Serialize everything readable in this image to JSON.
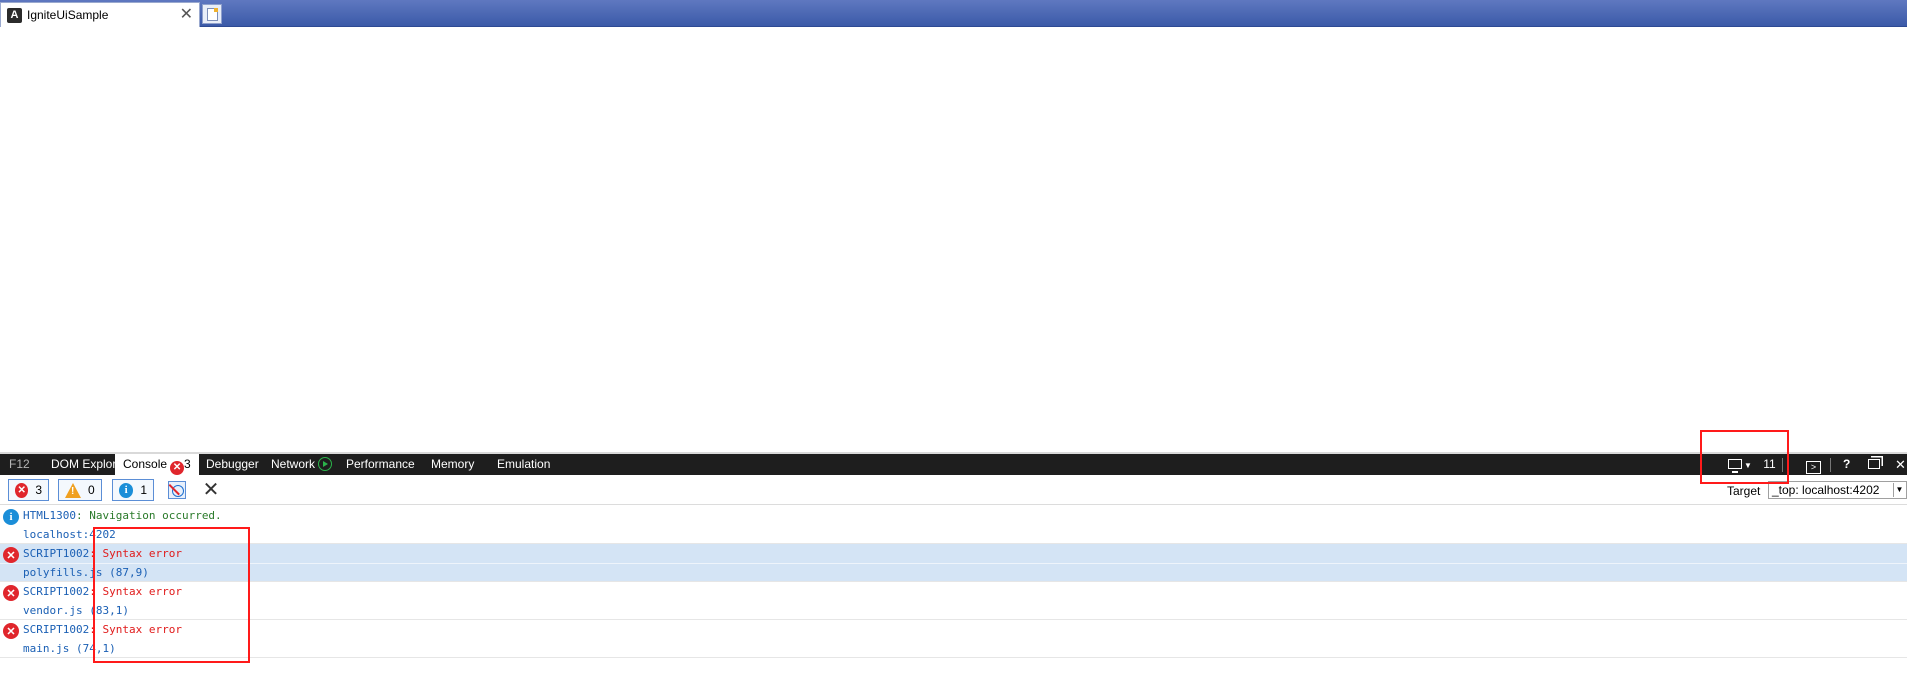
{
  "browser": {
    "tab_title": "IgniteUiSample",
    "tab_favicon": "A",
    "close_glyph": "✕"
  },
  "devtools": {
    "tabs": {
      "f12": "F12",
      "dom_explorer": "DOM Explorer",
      "console": "Console",
      "console_error_count": "3",
      "debugger": "Debugger",
      "network": "Network",
      "performance": "Performance",
      "memory": "Memory",
      "emulation": "Emulation"
    },
    "document_mode": "11",
    "help": "?",
    "close": "✕"
  },
  "toolbar": {
    "errors_count": "3",
    "warnings_count": "0",
    "info_count": "1",
    "target_label": "Target",
    "target_value": "_top: localhost:4202"
  },
  "messages": [
    {
      "type": "info",
      "code": "HTML1300",
      "text": ": Navigation occurred.",
      "source": "localhost:4202"
    },
    {
      "type": "error",
      "code": "SCRIPT1002",
      "text": ": Syntax error",
      "source": "polyfills.js (87,9)"
    },
    {
      "type": "error",
      "code": "SCRIPT1002",
      "text": ": Syntax error",
      "source": "vendor.js (83,1)"
    },
    {
      "type": "error",
      "code": "SCRIPT1002",
      "text": ": Syntax error",
      "source": "main.js (74,1)"
    }
  ],
  "colors": {
    "error": "#e0262c",
    "info": "#1b8ed8",
    "annotation": "#ff1a1a",
    "selected_row": "#d4e4f5"
  },
  "icons": [
    "angular-icon",
    "close-icon",
    "new-tab-icon",
    "error-icon",
    "warning-icon",
    "info-icon",
    "network-play-icon",
    "monitor-icon",
    "console-prompt-icon",
    "help-icon",
    "undock-icon",
    "clear-console-icon",
    "clear-on-navigate-icon"
  ]
}
